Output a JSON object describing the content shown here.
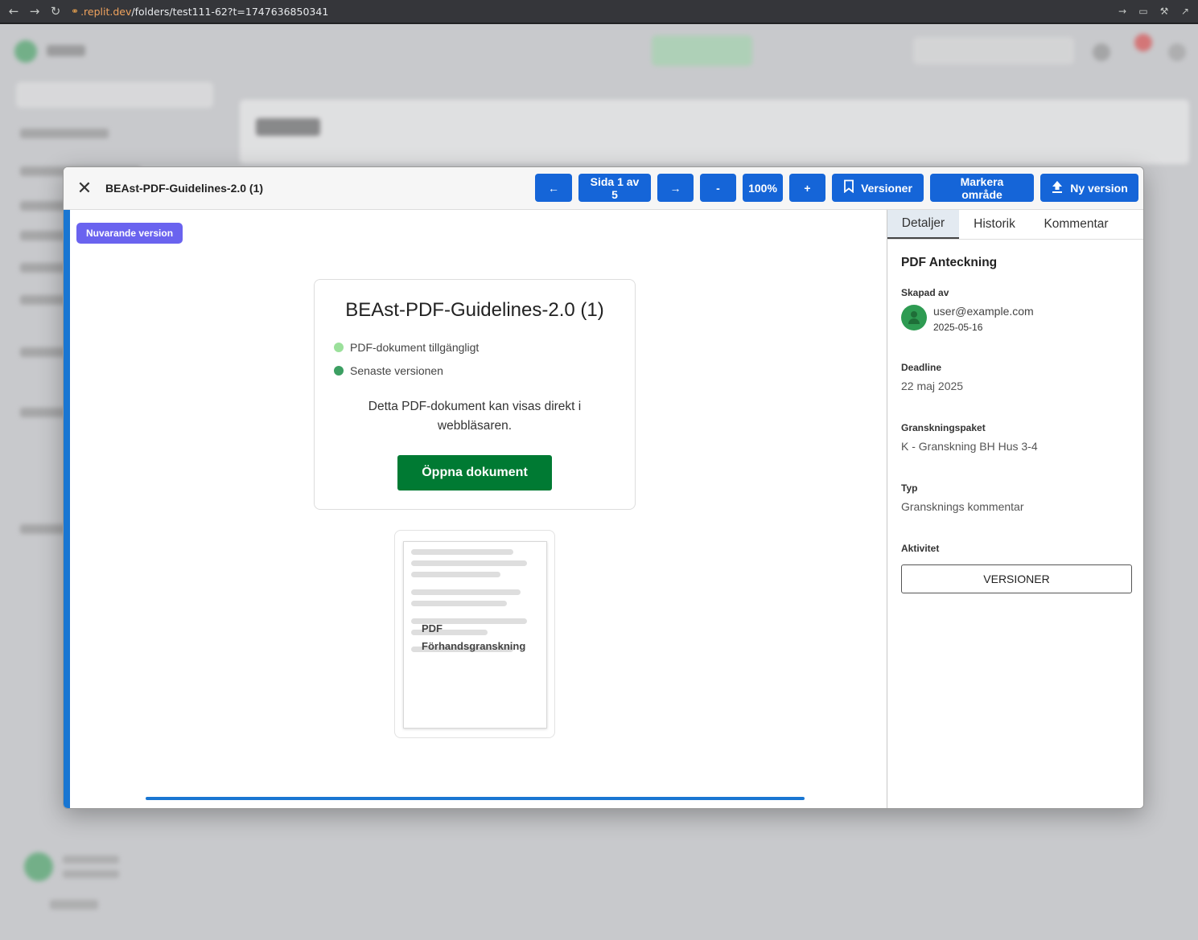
{
  "browser": {
    "url_host": ".replit.dev",
    "url_path": "/folders/test111-62?t=1747636850341"
  },
  "modal": {
    "title": "BEAst-PDF-Guidelines-2.0 (1)",
    "toolbar": {
      "prev": "←",
      "page_indicator": "Sida 1 av 5",
      "next": "→",
      "zoom_out": "-",
      "zoom_level": "100%",
      "zoom_in": "+",
      "versions": "Versioner",
      "mark_area": "Markera område",
      "new_version": "Ny version"
    },
    "viewer": {
      "version_badge": "Nuvarande version",
      "doc_title": "BEAst-PDF-Guidelines-2.0 (1)",
      "status_items": [
        {
          "label": "PDF-dokument tillgängligt",
          "color": "#9be09b"
        },
        {
          "label": "Senaste versionen",
          "color": "#3c9f62"
        }
      ],
      "description": "Detta PDF-dokument kan visas direkt i webbläsaren.",
      "open_button": "Öppna dokument",
      "preview_label_line1": "PDF",
      "preview_label_line2": "Förhandsgranskning"
    },
    "side_panel": {
      "tabs": [
        "Detaljer",
        "Historik",
        "Kommentar"
      ],
      "active_tab": "Detaljer",
      "heading": "PDF Anteckning",
      "created_by_label": "Skapad av",
      "created_by_email": "user@example.com",
      "created_date": "2025-05-16",
      "deadline_label": "Deadline",
      "deadline_value": "22 maj 2025",
      "package_label": "Granskningspaket",
      "package_value": "K - Granskning BH Hus 3-4",
      "type_label": "Typ",
      "type_value": "Gransknings kommentar",
      "activity_label": "Aktivitet",
      "versions_button": "VERSIONER"
    }
  },
  "colors": {
    "primary_button": "#1565d8",
    "badge": "#6a63ef",
    "open_button": "#007a33",
    "accent": "#1976d2"
  }
}
